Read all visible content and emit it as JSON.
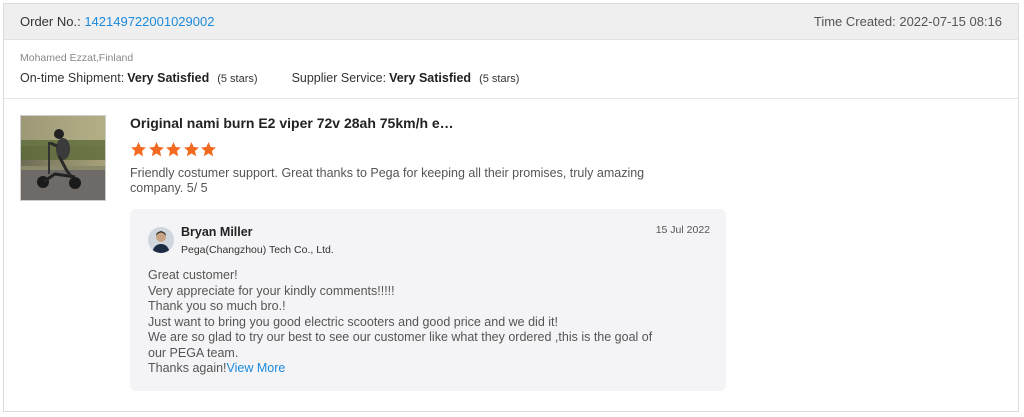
{
  "order": {
    "number_label": "Order No.:",
    "number": "142149722001029002",
    "time_created": "Time Created: 2022-07-15 08:16"
  },
  "buyer": {
    "name": "Mohamed Ezzat,Finland",
    "ratings": [
      {
        "label": "On-time Shipment:",
        "value": "Very Satisfied",
        "stars": "(5 stars)"
      },
      {
        "label": "Supplier Service:",
        "value": "Very Satisfied",
        "stars": "(5 stars)"
      }
    ]
  },
  "review": {
    "product_title": "Original nami burn E2 viper 72v 28ah 75km/h e…",
    "star_rating": 5,
    "star_color": "#f26a21",
    "text": "Friendly costumer support. Great thanks to Pega for keeping all their promises, truly amazing company. 5/ 5"
  },
  "reply": {
    "author": "Bryan Miller",
    "company": "Pega(Changzhou) Tech Co., Ltd.",
    "date": "15 Jul 2022",
    "lines": [
      "Great customer!",
      "Very appreciate for your kindly comments!!!!!",
      "Thank you so much bro.!",
      "Just want to bring you good electric scooters and good price and we did it!",
      "We are so glad to try our best to see our customer like what they ordered ,this is the goal of our PEGA team.",
      "Thanks again!"
    ],
    "view_more": "View More"
  },
  "colors": {
    "link": "#1a8bdc",
    "header_bg": "#efefef",
    "reply_bg": "#f4f4f6"
  }
}
